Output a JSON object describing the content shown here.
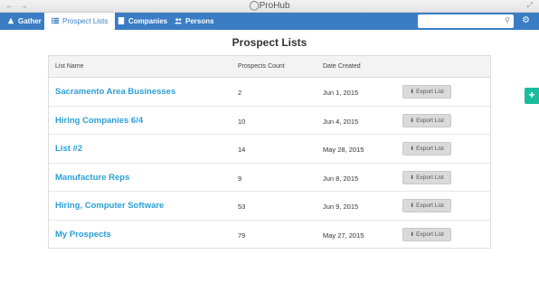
{
  "window": {
    "title": "ProHub",
    "nav_arrows": "← →",
    "expand_glyph": "⤢"
  },
  "navbar": {
    "items": [
      {
        "label": "Gather"
      },
      {
        "label": "Prospect Lists"
      },
      {
        "label": "Companies"
      },
      {
        "label": "Persons"
      }
    ],
    "search": {
      "placeholder": "",
      "value": ""
    },
    "colors": {
      "bar": "#3a7dc4",
      "active_bg": "#ffffff"
    }
  },
  "main": {
    "title": "Prospect Lists",
    "columns": [
      "List Name",
      "Prospects Count",
      "Date Created",
      ""
    ],
    "rows": [
      {
        "name": "Sacramento Area Businesses",
        "count": "2",
        "date": "Jun 1, 2015",
        "action": "Export List"
      },
      {
        "name": "Hiring Companies 6/4",
        "count": "10",
        "date": "Jun 4, 2015",
        "action": "Export List"
      },
      {
        "name": "List #2",
        "count": "14",
        "date": "May 28, 2015",
        "action": "Export List"
      },
      {
        "name": "Manufacture Reps",
        "count": "9",
        "date": "Jun 8, 2015",
        "action": "Export List"
      },
      {
        "name": "Hiring, Computer Software",
        "count": "53",
        "date": "Jun 9, 2015",
        "action": "Export List"
      },
      {
        "name": "My Prospects",
        "count": "79",
        "date": "May 27, 2015",
        "action": "Export List"
      }
    ]
  },
  "fab": {
    "label": "+",
    "color": "#1abc9c"
  },
  "icons": [
    "logo-icon",
    "gather-icon",
    "list-icon",
    "companies-icon",
    "persons-icon",
    "search-icon",
    "settings-icon",
    "download-icon"
  ]
}
